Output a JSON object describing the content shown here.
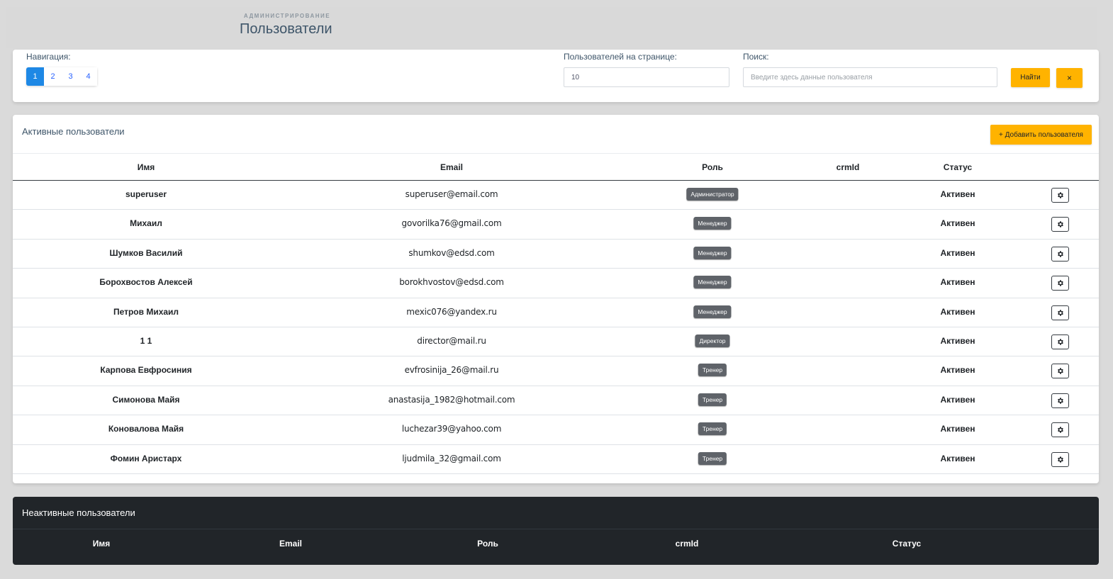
{
  "header": {
    "breadcrumb": "АДМИНИСТРИРОВАНИЕ",
    "title": "Пользователи"
  },
  "filters": {
    "navigation_label": "Навигация:",
    "pages": [
      "1",
      "2",
      "3",
      "4"
    ],
    "active_page": "1",
    "per_page_label": "Пользователей на странице:",
    "per_page_value": "10",
    "search_label": "Поиск:",
    "search_placeholder": "Введите здесь данные пользователя",
    "search_button": "Найти",
    "clear_button": "×"
  },
  "active_users": {
    "title": "Активные пользователи",
    "add_button": "+ Добавить пользователя",
    "columns": [
      "Имя",
      "Email",
      "Роль",
      "crmId",
      "Статус"
    ],
    "rows": [
      {
        "name": "superuser",
        "email": "superuser@email.com",
        "role": "Администратор",
        "crmId": "",
        "status": "Активен"
      },
      {
        "name": "Михаил",
        "email": "govorilka76@gmail.com",
        "role": "Менеджер",
        "crmId": "",
        "status": "Активен"
      },
      {
        "name": "Шумков Василий",
        "email": "shumkov@edsd.com",
        "role": "Менеджер",
        "crmId": "",
        "status": "Активен"
      },
      {
        "name": "Борохвостов Алексей",
        "email": "borokhvostov@edsd.com",
        "role": "Менеджер",
        "crmId": "",
        "status": "Активен"
      },
      {
        "name": "Петров Михаил",
        "email": "mexic076@yandex.ru",
        "role": "Менеджер",
        "crmId": "",
        "status": "Активен"
      },
      {
        "name": "1 1",
        "email": "director@mail.ru",
        "role": "Директор",
        "crmId": "",
        "status": "Активен"
      },
      {
        "name": "Карпова Евфросиния",
        "email": "evfrosinija_26@mail.ru",
        "role": "Тренер",
        "crmId": "",
        "status": "Активен"
      },
      {
        "name": "Симонова Майя",
        "email": "anastasija_1982@hotmail.com",
        "role": "Тренер",
        "crmId": "",
        "status": "Активен"
      },
      {
        "name": "Коновалова Майя",
        "email": "luchezar39@yahoo.com",
        "role": "Тренер",
        "crmId": "",
        "status": "Активен"
      },
      {
        "name": "Фомин Аристарх",
        "email": "ljudmila_32@gmail.com",
        "role": "Тренер",
        "crmId": "",
        "status": "Активен"
      }
    ]
  },
  "inactive_users": {
    "title": "Неактивные пользователи",
    "columns": [
      "Имя",
      "Email",
      "Роль",
      "crmId",
      "Статус"
    ]
  },
  "icons": {
    "row_action": "gear-icon"
  },
  "colors": {
    "accent_yellow": "#ffb300",
    "pagination_active": "#1e88e5",
    "badge_gray": "#5f6369",
    "dark_card": "#212529"
  }
}
